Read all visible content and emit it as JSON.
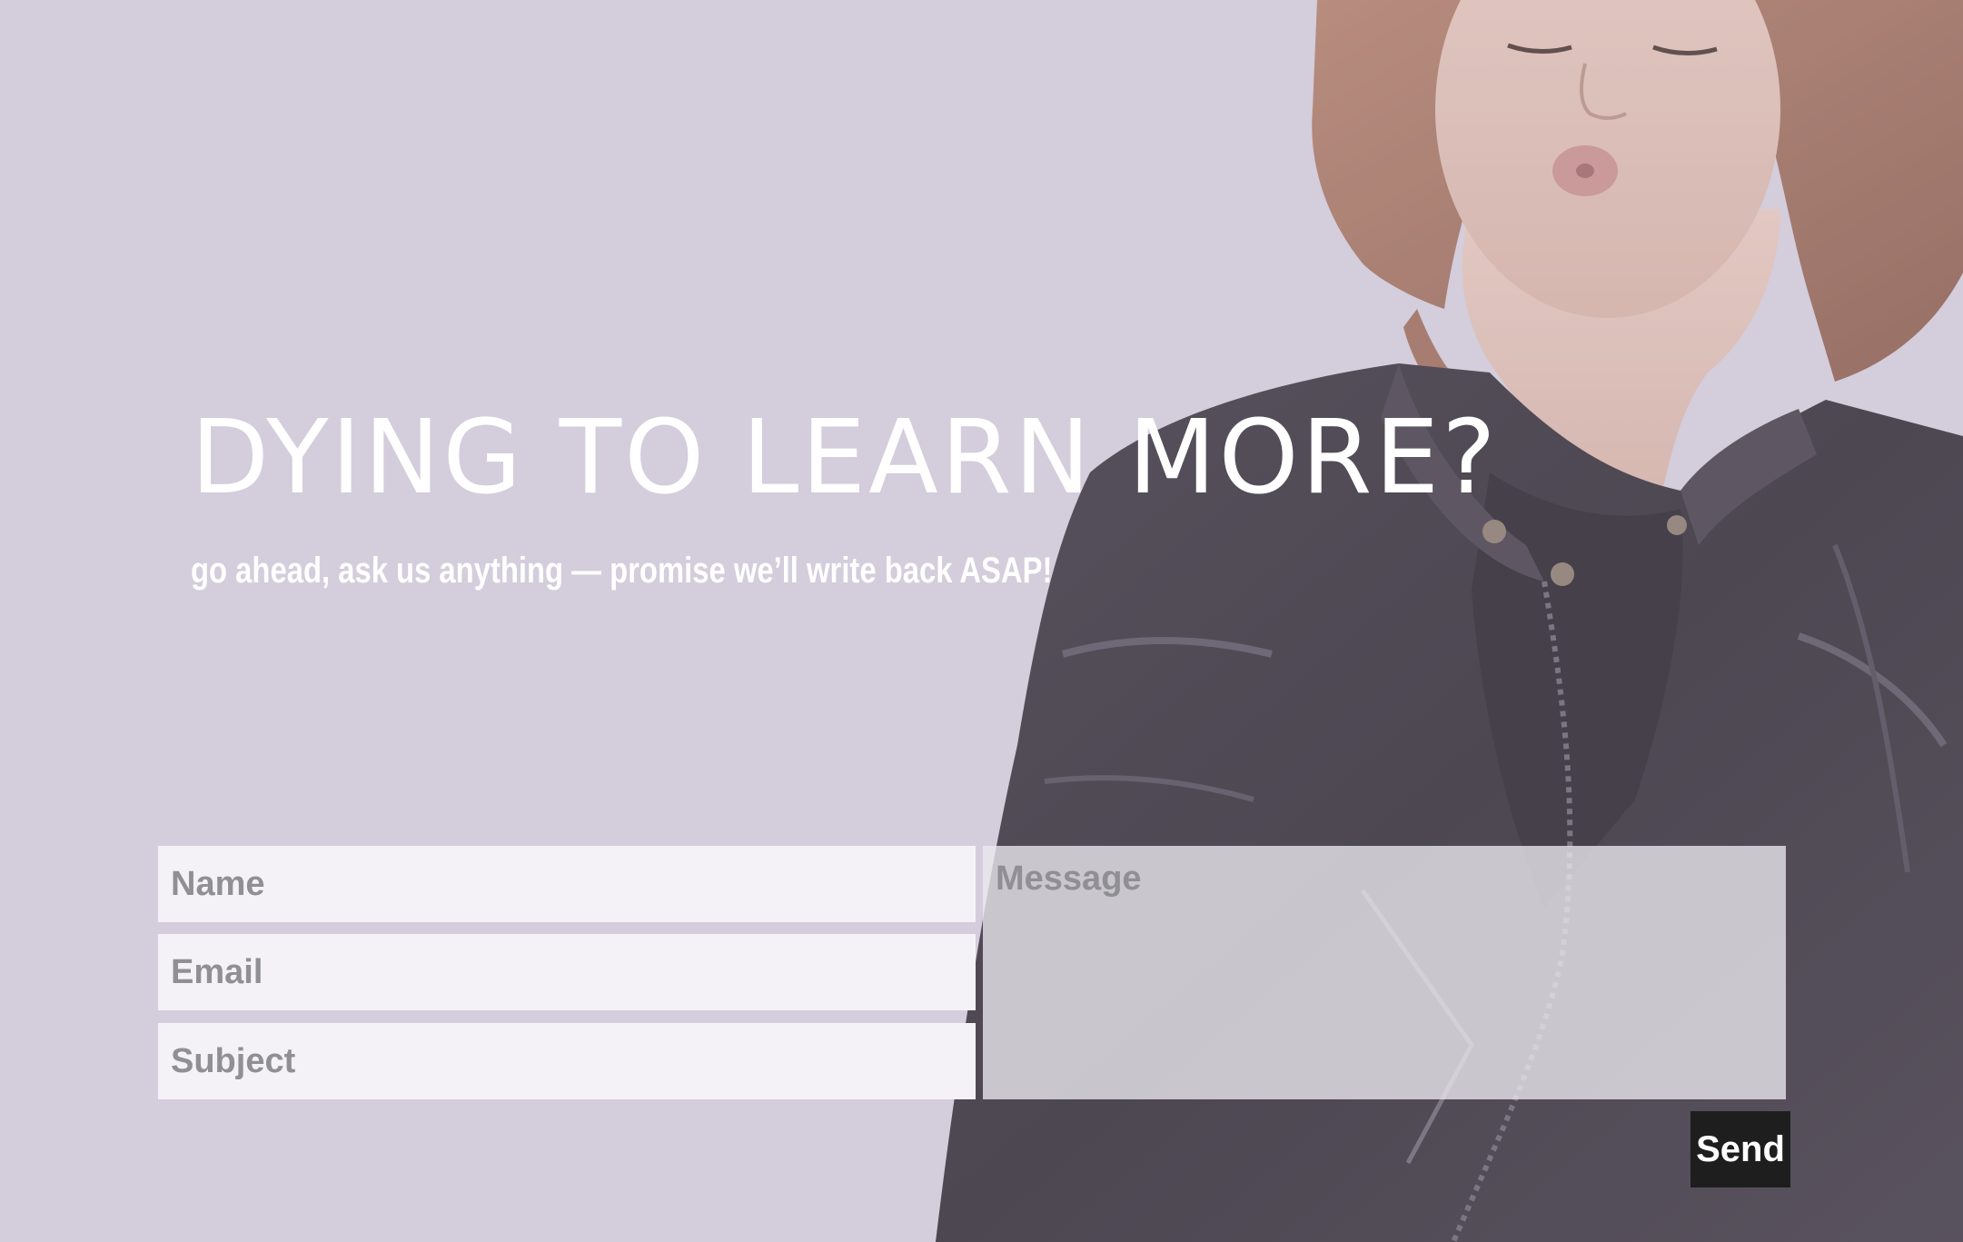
{
  "hero": {
    "headline": "DYING TO LEARN MORE?",
    "subheadline": "go ahead, ask us anything — promise we’ll write back ASAP!"
  },
  "form": {
    "name_placeholder": "Name",
    "email_placeholder": "Email",
    "subject_placeholder": "Subject",
    "message_placeholder": "Message",
    "send_label": "Send"
  },
  "colors": {
    "background": "#d4cedc",
    "headline_text": "#ffffff",
    "field_background": "#f4f2f7",
    "button_background": "#1e1e1f",
    "jacket": "#2f2a33"
  }
}
